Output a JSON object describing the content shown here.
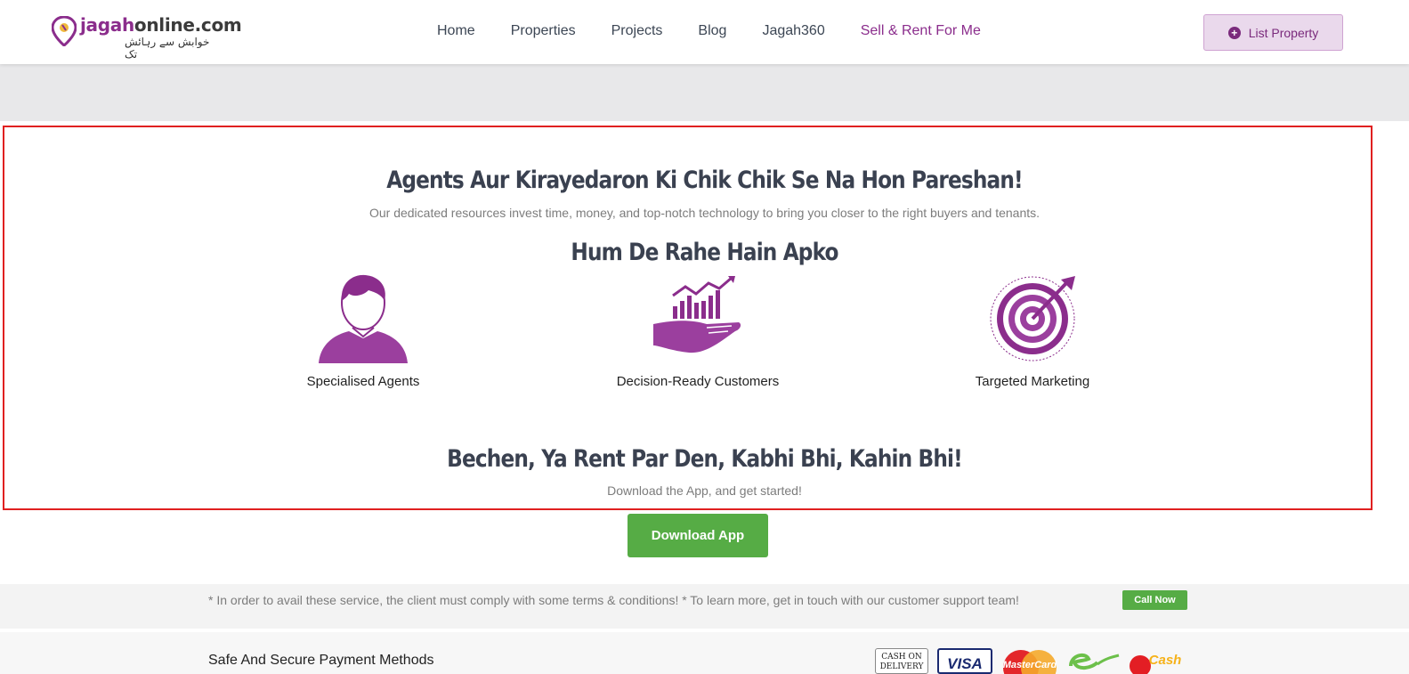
{
  "header": {
    "logo": {
      "text_brand": "jagah",
      "text_rest": "online.com",
      "tagline_urdu": "خوابش سے رہائش تک"
    },
    "nav": [
      {
        "label": "Home"
      },
      {
        "label": "Properties"
      },
      {
        "label": "Projects"
      },
      {
        "label": "Blog"
      },
      {
        "label": "Jagah360"
      },
      {
        "label": "Sell & Rent For Me"
      }
    ],
    "list_property_label": "List Property"
  },
  "section": {
    "heading": "Agents Aur Kirayedaron Ki Chik Chik Se Na Hon Pareshan!",
    "subheading": "Our dedicated resources invest time, money, and top-notch technology to bring you closer to the right buyers and tenants.",
    "offer_heading": "Hum De Rahe Hain Apko",
    "features": [
      {
        "label": "Specialised Agents",
        "icon": "person-icon"
      },
      {
        "label": "Decision-Ready Customers",
        "icon": "hand-chart-icon"
      },
      {
        "label": "Targeted Marketing",
        "icon": "target-icon"
      }
    ],
    "cta_heading": "Bechen, Ya Rent Par Den, Kabhi Bhi, Kahin Bhi!",
    "cta_sub": "Download the App, and get started!"
  },
  "download_label": "Download App",
  "terms": {
    "text": "* In order to avail these service, the client must comply with some terms & conditions! * To learn more, get in touch with our customer support team!",
    "call_label": "Call Now"
  },
  "payment": {
    "title": "Safe And Secure Payment Methods",
    "cod_line1": "CASH ON",
    "cod_line2": "DELIVERY",
    "visa": "VISA",
    "mastercard": "MasterCard",
    "jazzcash": "Cash"
  },
  "colors": {
    "brand": "#8b2d8c",
    "green": "#56ac45",
    "heading": "#3a4150"
  }
}
